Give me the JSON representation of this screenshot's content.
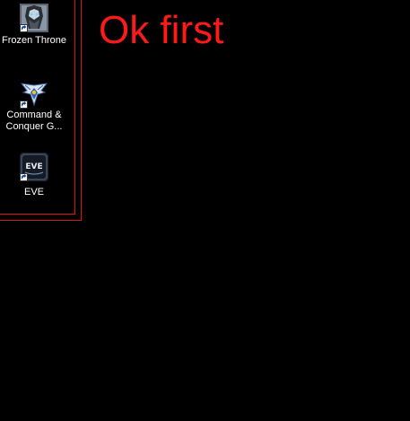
{
  "annotation": {
    "text": "Ok first",
    "color": "#ff1a1a"
  },
  "desktop": {
    "icons": [
      {
        "label": "Frozen Throne",
        "icon": "frozen-throne-icon"
      },
      {
        "label": "Command &",
        "label2": "Conquer G...",
        "icon": "command-conquer-icon"
      },
      {
        "label": "EVE",
        "icon": "eve-icon"
      }
    ]
  },
  "colors": {
    "background": "#000000",
    "highlight_box": "#e01010",
    "label_text": "#ffffff"
  }
}
